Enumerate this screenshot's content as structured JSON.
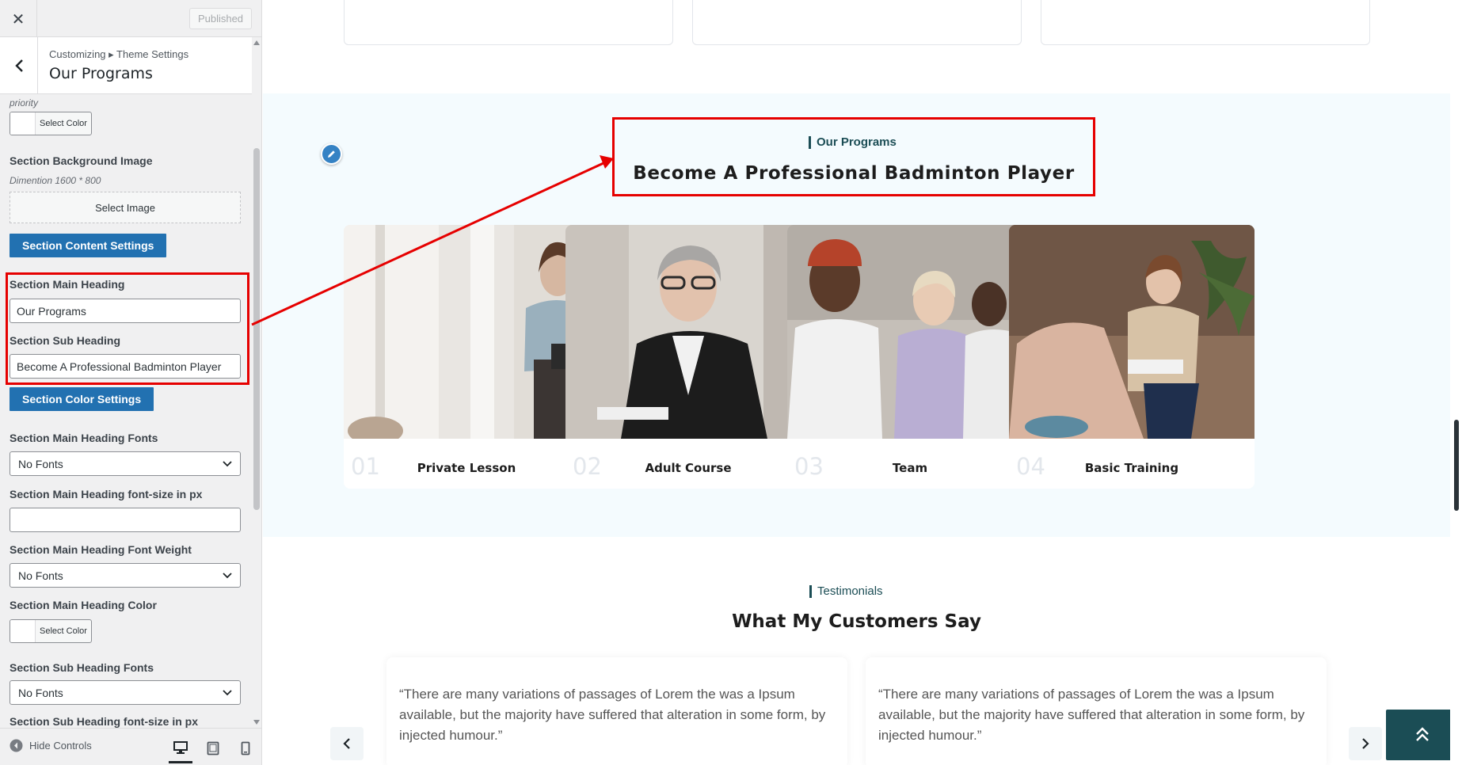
{
  "sidebar": {
    "close_icon": "close-icon",
    "published_label": "Published",
    "breadcrumb": "Customizing ▸ Theme Settings",
    "title": "Our Programs",
    "priority_note": "priority",
    "select_color_label": "Select Color",
    "bg_image_label": "Section Background Image",
    "bg_image_note": "Dimention 1600 * 800",
    "select_image_label": "Select Image",
    "content_settings_btn": "Section Content Settings",
    "main_heading_label": "Section Main Heading",
    "main_heading_value": "Our Programs",
    "sub_heading_label": "Section Sub Heading",
    "sub_heading_value": "Become A Professional Badminton Player",
    "color_settings_btn": "Section Color Settings",
    "main_heading_fonts_label": "Section Main Heading Fonts",
    "main_heading_fonts_value": "No Fonts",
    "main_heading_size_label": "Section Main Heading font-size in px",
    "main_heading_size_value": "",
    "main_heading_weight_label": "Section Main Heading Font Weight",
    "main_heading_weight_value": "No Fonts",
    "main_heading_color_label": "Section Main Heading Color",
    "sub_heading_fonts_label": "Section Sub Heading Fonts",
    "sub_heading_fonts_value": "No Fonts",
    "sub_heading_size_label": "Section Sub Heading font-size in px",
    "hide_controls_label": "Hide Controls",
    "devices": [
      "desktop",
      "tablet",
      "mobile"
    ]
  },
  "preview": {
    "programs": {
      "eyebrow": "Our Programs",
      "title": "Become A Professional Badminton Player",
      "cards": [
        {
          "num": "01",
          "name": "Private Lesson"
        },
        {
          "num": "02",
          "name": "Adult Course"
        },
        {
          "num": "03",
          "name": "Team"
        },
        {
          "num": "04",
          "name": "Basic Training"
        }
      ]
    },
    "testimonials": {
      "eyebrow": "Testimonials",
      "title": "What My Customers Say",
      "quotes": [
        "“There are many variations of passages of Lorem the was a Ipsum available, but the majority have suffered that alteration in some form, by injected humour.”",
        "“There are many variations of passages of Lorem the was a Ipsum available, but the majority have suffered that alteration in some form, by injected humour.”"
      ]
    }
  },
  "colors": {
    "accent": "#2271b1",
    "highlight": "#e60000",
    "brand_dark": "#1b4d55",
    "section_bg": "#f4fbfe"
  }
}
